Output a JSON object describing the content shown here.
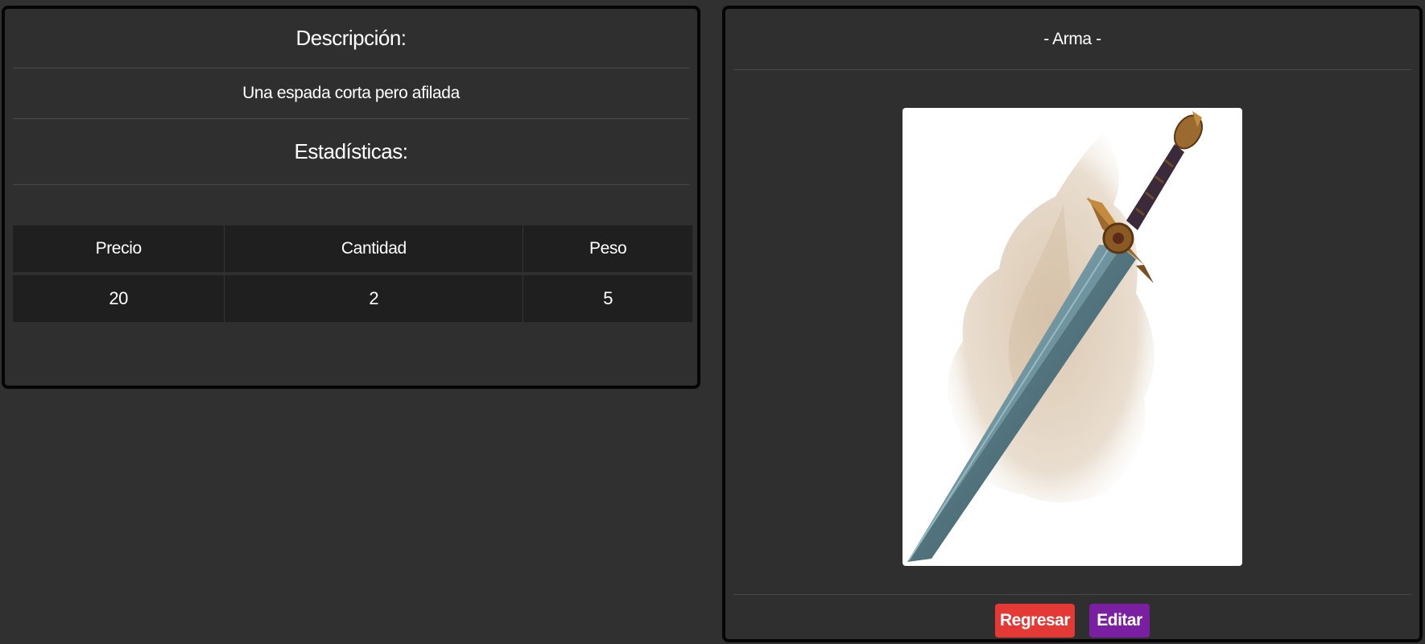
{
  "details": {
    "description_heading": "Descripción:",
    "description_text": "Una espada corta pero afilada",
    "stats_heading": "Estadísticas:",
    "stats_table": {
      "headers": [
        "Precio",
        "Cantidad",
        "Peso"
      ],
      "rows": [
        [
          "20",
          "2",
          "5"
        ]
      ]
    }
  },
  "item": {
    "category_title": "- Arma -",
    "image_icon": "sword-illustration"
  },
  "actions": {
    "back_label": "Regresar",
    "edit_label": "Editar"
  },
  "colors": {
    "background": "#303030",
    "card": "#2f2f2f",
    "card_border": "#050505",
    "table_cell": "#1f1f1f",
    "back_button": "#e53935",
    "edit_button": "#7b1fa2"
  }
}
